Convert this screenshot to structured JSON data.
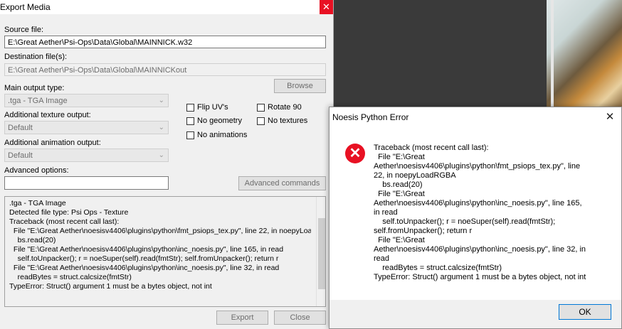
{
  "export_media": {
    "title": "Export Media",
    "close_glyph": "✕",
    "source_label": "Source file:",
    "source_value": "E:\\Great Aether\\Psi-Ops\\Data\\Global\\MAINNICK.w32",
    "dest_label": "Destination file(s):",
    "dest_value": "E:\\Great Aether\\Psi-Ops\\Data\\Global\\MAINNICKout",
    "browse_label": "Browse",
    "main_output_label": "Main output type:",
    "main_output_value": ".tga - TGA Image",
    "texture_output_label": "Additional texture output:",
    "texture_output_value": "Default",
    "animation_output_label": "Additional animation output:",
    "animation_output_value": "Default",
    "advanced_options_label": "Advanced options:",
    "advanced_options_value": "",
    "advanced_commands_label": "Advanced commands",
    "checkboxes": {
      "flip_uvs": "Flip UV's",
      "rotate_90": "Rotate 90",
      "no_geometry": "No geometry",
      "no_textures": "No textures",
      "no_animations": "No animations"
    },
    "log": ".tga - TGA Image\nDetected file type: Psi Ops - Texture\nTraceback (most recent call last):\n  File \"E:\\Great Aether\\noesisv4406\\plugins\\python\\fmt_psiops_tex.py\", line 22, in noepyLoadRGBA\n    bs.read(20)\n  File \"E:\\Great Aether\\noesisv4406\\plugins\\python\\inc_noesis.py\", line 165, in read\n    self.toUnpacker(); r = noeSuper(self).read(fmtStr); self.fromUnpacker(); return r\n  File \"E:\\Great Aether\\noesisv4406\\plugins\\python\\inc_noesis.py\", line 32, in read\n    readBytes = struct.calcsize(fmtStr)\nTypeError: Struct() argument 1 must be a bytes object, not int",
    "export_label": "Export",
    "close_label": "Close"
  },
  "error_dialog": {
    "title": "Noesis Python Error",
    "close_glyph": "✕",
    "icon_glyph": "✕",
    "message": "Traceback (most recent call last):\n  File \"E:\\Great\nAether\\noesisv4406\\plugins\\python\\fmt_psiops_tex.py\", line\n22, in noepyLoadRGBA\n    bs.read(20)\n  File \"E:\\Great\nAether\\noesisv4406\\plugins\\python\\inc_noesis.py\", line 165,\nin read\n    self.toUnpacker(); r = noeSuper(self).read(fmtStr);\nself.fromUnpacker(); return r\n  File \"E:\\Great\nAether\\noesisv4406\\plugins\\python\\inc_noesis.py\", line 32, in\nread\n    readBytes = struct.calcsize(fmtStr)\nTypeError: Struct() argument 1 must be a bytes object, not int",
    "ok_label": "OK"
  },
  "colors": {
    "close_red": "#e81123",
    "focus_blue": "#0078d7"
  }
}
